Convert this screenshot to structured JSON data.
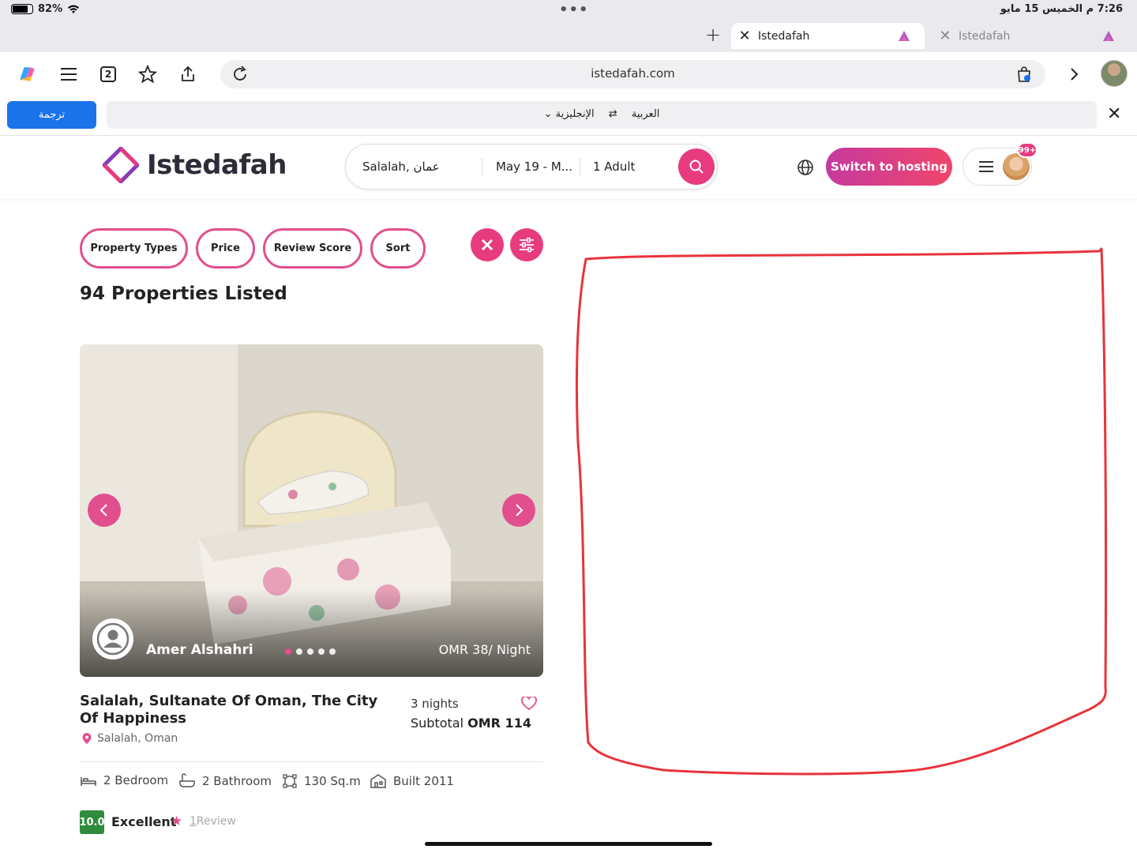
{
  "status_bar": {
    "battery": "82%",
    "datetime": "7:26 م الخميس 15 مايو"
  },
  "tabs": [
    {
      "label": "Istedafah",
      "active": true
    },
    {
      "label": "Istedafah",
      "active": false
    }
  ],
  "toolbar": {
    "tab_count": "2",
    "url": "istedafah.com"
  },
  "translate": {
    "button": "ترجمة",
    "from": "الإنجليزية",
    "to": "العربية"
  },
  "header": {
    "logo": "Istedafah",
    "search_location": "Salalah, عمان",
    "search_dates": "May 19 - M...",
    "search_guests": "1 Adult",
    "hosting_button": "Switch to hosting",
    "notifications": "99+"
  },
  "filters": [
    "Property Types",
    "Price",
    "Review Score",
    "Sort"
  ],
  "listing": {
    "count_title": "94 Properties Listed",
    "host": "Amer Alshahri",
    "price_night": "OMR 38/ Night",
    "title": "Salalah, Sultanate Of Oman, The City Of Happiness",
    "location": "Salalah, Oman",
    "nights": "3 nights",
    "subtotal_label": "Subtotal",
    "subtotal_value": "OMR 114",
    "amenities": {
      "bedroom": "2 Bedroom",
      "bathroom": "2 Bathroom",
      "area": "130 Sq.m",
      "built": "Built 2011"
    },
    "score": "10.0",
    "score_label": "Excellent",
    "review_count": "1",
    "review_label": "Review"
  },
  "colors": {
    "brand": "#e24f8e",
    "translate_button": "#1a73e8",
    "score_badge": "#2e8b3c",
    "annotation": "#e8333c"
  }
}
